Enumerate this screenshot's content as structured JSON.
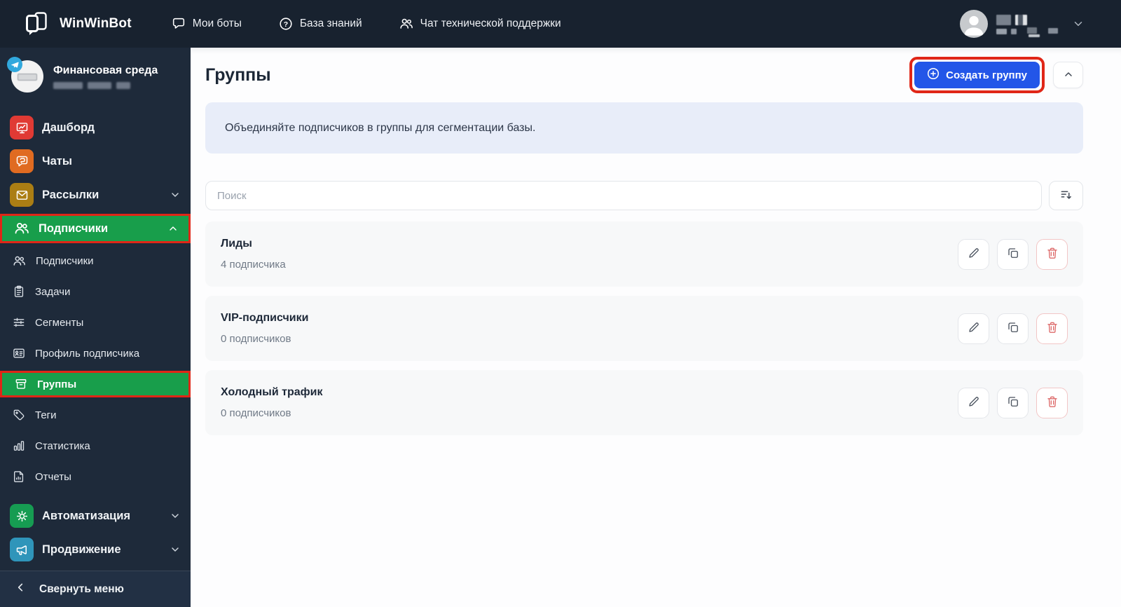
{
  "topbar": {
    "brand": "WinWinBot",
    "nav": [
      {
        "label": "Мои боты"
      },
      {
        "label": "База знаний"
      },
      {
        "label": "Чат технической поддержки"
      }
    ]
  },
  "icons": {
    "question_glyph": "?"
  },
  "sidebar": {
    "profile": {
      "name": "Финансовая среда"
    },
    "menu": [
      {
        "label": "Дашборд"
      },
      {
        "label": "Чаты"
      },
      {
        "label": "Рассылки"
      },
      {
        "label": "Подписчики"
      }
    ],
    "submenu": [
      {
        "label": "Подписчики"
      },
      {
        "label": "Задачи"
      },
      {
        "label": "Сегменты"
      },
      {
        "label": "Профиль подписчика"
      },
      {
        "label": "Группы"
      },
      {
        "label": "Теги"
      },
      {
        "label": "Статистика"
      },
      {
        "label": "Отчеты"
      }
    ],
    "menu2": [
      {
        "label": "Автоматизация"
      },
      {
        "label": "Продвижение"
      }
    ],
    "collapse_label": "Свернуть меню"
  },
  "main": {
    "title": "Группы",
    "create_button": "Создать группу",
    "banner": "Объединяйте подписчиков в группы для сегментации базы.",
    "search": {
      "placeholder": "Поиск"
    },
    "groups": [
      {
        "name": "Лиды",
        "subscribers": "4 подписчика"
      },
      {
        "name": "VIP-подписчики",
        "subscribers": "0 подписчиков"
      },
      {
        "name": "Холодный трафик",
        "subscribers": "0 подписчиков"
      }
    ]
  },
  "colors": {
    "topbar_bg": "#18222F",
    "sidebar_bg": "#1E2A3A",
    "accent_green": "#189E4B",
    "annotation_red": "#E02617",
    "primary_blue": "#2356E8",
    "banner_bg": "#E8EDF9",
    "icon_red": "#E03A34",
    "icon_orange": "#E06B21",
    "icon_gold": "#AB7E14",
    "icon_green": "#169C52",
    "icon_teal": "#2F95BA"
  }
}
